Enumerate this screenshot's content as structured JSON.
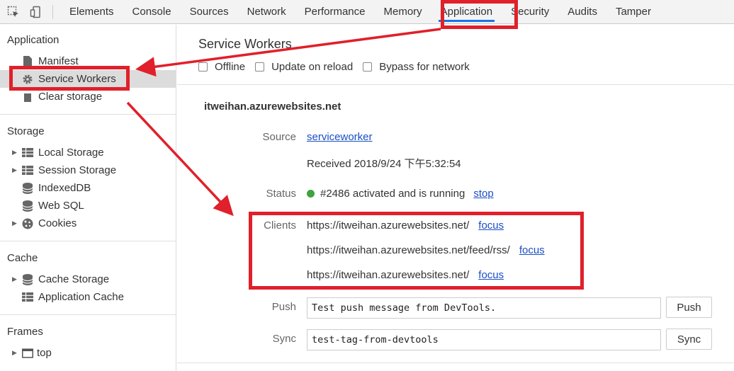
{
  "tabs": [
    {
      "label": "Elements"
    },
    {
      "label": "Console"
    },
    {
      "label": "Sources"
    },
    {
      "label": "Network"
    },
    {
      "label": "Performance"
    },
    {
      "label": "Memory"
    },
    {
      "label": "Application",
      "selected": true
    },
    {
      "label": "Security"
    },
    {
      "label": "Audits"
    },
    {
      "label": "Tamper"
    }
  ],
  "sidebar": {
    "application": {
      "title": "Application",
      "items": [
        {
          "label": "Manifest",
          "icon": "file-icon"
        },
        {
          "label": "Service Workers",
          "icon": "gear-icon",
          "selected": true
        },
        {
          "label": "Clear storage",
          "icon": "trash-icon"
        }
      ]
    },
    "storage": {
      "title": "Storage",
      "items": [
        {
          "label": "Local Storage",
          "icon": "grid-icon",
          "expandable": true
        },
        {
          "label": "Session Storage",
          "icon": "grid-icon",
          "expandable": true
        },
        {
          "label": "IndexedDB",
          "icon": "database-icon"
        },
        {
          "label": "Web SQL",
          "icon": "database-icon"
        },
        {
          "label": "Cookies",
          "icon": "cookie-icon",
          "expandable": true
        }
      ]
    },
    "cache": {
      "title": "Cache",
      "items": [
        {
          "label": "Cache Storage",
          "icon": "database-icon",
          "expandable": true
        },
        {
          "label": "Application Cache",
          "icon": "grid-icon"
        }
      ]
    },
    "frames": {
      "title": "Frames",
      "items": [
        {
          "label": "top",
          "icon": "frame-icon",
          "expandable": true
        }
      ]
    }
  },
  "main": {
    "title": "Service Workers",
    "options": {
      "offline": "Offline",
      "update_on_reload": "Update on reload",
      "bypass_for_network": "Bypass for network"
    },
    "origin": "itweihan.azurewebsites.net",
    "source_label": "Source",
    "source_link": "serviceworker",
    "received": "Received 2018/9/24 下午5:32:54",
    "status_label": "Status",
    "status_text": "#2486 activated and is running",
    "status_action": "stop",
    "status_color": "#3fa33f",
    "clients_label": "Clients",
    "clients": [
      {
        "url": "https://itweihan.azurewebsites.net/",
        "action": "focus"
      },
      {
        "url": "https://itweihan.azurewebsites.net/feed/rss/",
        "action": "focus"
      },
      {
        "url": "https://itweihan.azurewebsites.net/",
        "action": "focus"
      }
    ],
    "push_label": "Push",
    "push_value": "Test push message from DevTools.",
    "push_button": "Push",
    "sync_label": "Sync",
    "sync_value": "test-tag-from-devtools",
    "sync_button": "Sync"
  },
  "annotation_color": "#e0202a"
}
